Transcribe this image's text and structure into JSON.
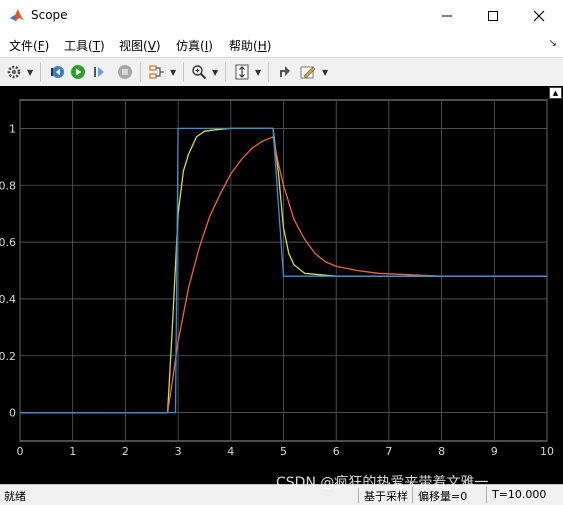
{
  "window": {
    "title": "Scope",
    "controls": [
      "minimize-icon",
      "maximize-icon",
      "close-icon"
    ]
  },
  "menu": {
    "items": [
      {
        "text": "文件(",
        "key": "F",
        "end": ")"
      },
      {
        "text": "工具(",
        "key": "T",
        "end": ")"
      },
      {
        "text": "视图(",
        "key": "V",
        "end": ")"
      },
      {
        "text": "仿真(",
        "key": "I",
        "end": ")"
      },
      {
        "text": "帮助(",
        "key": "H",
        "end": ")"
      }
    ]
  },
  "toolbar": {
    "icons": [
      "settings-icon",
      "step-back-icon",
      "run-icon",
      "step-forward-icon",
      "stop-icon",
      "signal-select-icon",
      "zoom-icon",
      "autoscale-icon",
      "triggers-icon",
      "style-icon"
    ]
  },
  "colors": {
    "background": "#000000",
    "grid": "#5a5a5a",
    "axis_text": "#d8d8d8",
    "run_green": "#2e9e2e"
  },
  "status": {
    "ready": "就绪",
    "mode": "基于采样",
    "offset": "偏移量=0",
    "time": "T=10.000"
  },
  "watermark": "CSDN @疯狂的热爱夹带着文雅一",
  "chart_data": {
    "type": "line",
    "xlim": [
      0,
      10
    ],
    "ylim": [
      -0.1,
      1.1
    ],
    "x_ticks": [
      "0",
      "1",
      "2",
      "3",
      "4",
      "5",
      "6",
      "7",
      "8",
      "9",
      "10"
    ],
    "y_ticks": [
      "0",
      "0.2",
      "0.4",
      "0.6",
      "0.8",
      "1"
    ],
    "grid": true,
    "series": [
      {
        "color": "#d9d94a",
        "x": [
          0,
          2.8,
          2.9,
          3.0,
          3.1,
          3.2,
          3.35,
          3.5,
          3.7,
          4.0,
          4.4,
          4.8,
          4.9,
          5.0,
          5.1,
          5.2,
          5.4,
          5.7,
          6.0,
          7.0,
          10.0
        ],
        "y": [
          0,
          0,
          0.33,
          0.7,
          0.85,
          0.91,
          0.97,
          0.99,
          0.995,
          1.0,
          1.0,
          1.0,
          0.85,
          0.65,
          0.56,
          0.52,
          0.49,
          0.485,
          0.48,
          0.48,
          0.48
        ]
      },
      {
        "color": "#e8683a",
        "x": [
          0,
          2.8,
          2.9,
          3.0,
          3.2,
          3.4,
          3.6,
          3.8,
          4.0,
          4.2,
          4.4,
          4.6,
          4.8,
          4.9,
          5.0,
          5.2,
          5.4,
          5.6,
          5.8,
          6.0,
          6.4,
          6.8,
          7.4,
          8.0,
          10.0
        ],
        "y": [
          0,
          0,
          0.12,
          0.25,
          0.44,
          0.58,
          0.69,
          0.77,
          0.84,
          0.89,
          0.93,
          0.955,
          0.97,
          0.88,
          0.8,
          0.68,
          0.61,
          0.56,
          0.53,
          0.515,
          0.5,
          0.49,
          0.485,
          0.48,
          0.48
        ]
      },
      {
        "color": "#3f8ed6",
        "x": [
          0,
          2.95,
          3.0,
          4.8,
          5.0,
          10.0
        ],
        "y": [
          0,
          0,
          1.0,
          1.0,
          0.48,
          0.48
        ]
      }
    ]
  }
}
